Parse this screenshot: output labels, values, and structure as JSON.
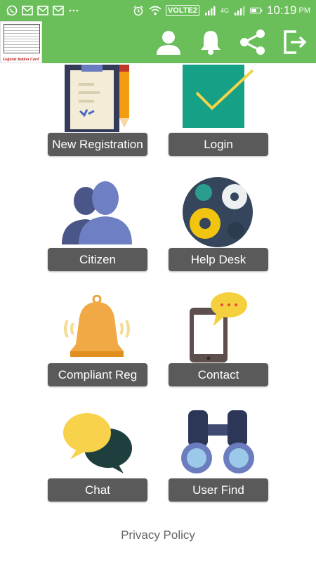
{
  "status_bar": {
    "volte": "VOLTE2",
    "network_1": "4G",
    "time": "10:19",
    "ampm": "PM"
  },
  "app_bar": {
    "logo_text": "Gujarat Ration Card"
  },
  "tiles": {
    "new_registration": "New Registration",
    "login": "Login",
    "citizen": "Citizen",
    "help_desk": "Help Desk",
    "compliant_reg": "Compliant Reg",
    "contact": "Contact",
    "chat": "Chat",
    "user_find": "User Find"
  },
  "footer": {
    "privacy": "Privacy Policy"
  },
  "colors": {
    "appbar": "#6abf5a",
    "button": "#5a5a5a"
  }
}
